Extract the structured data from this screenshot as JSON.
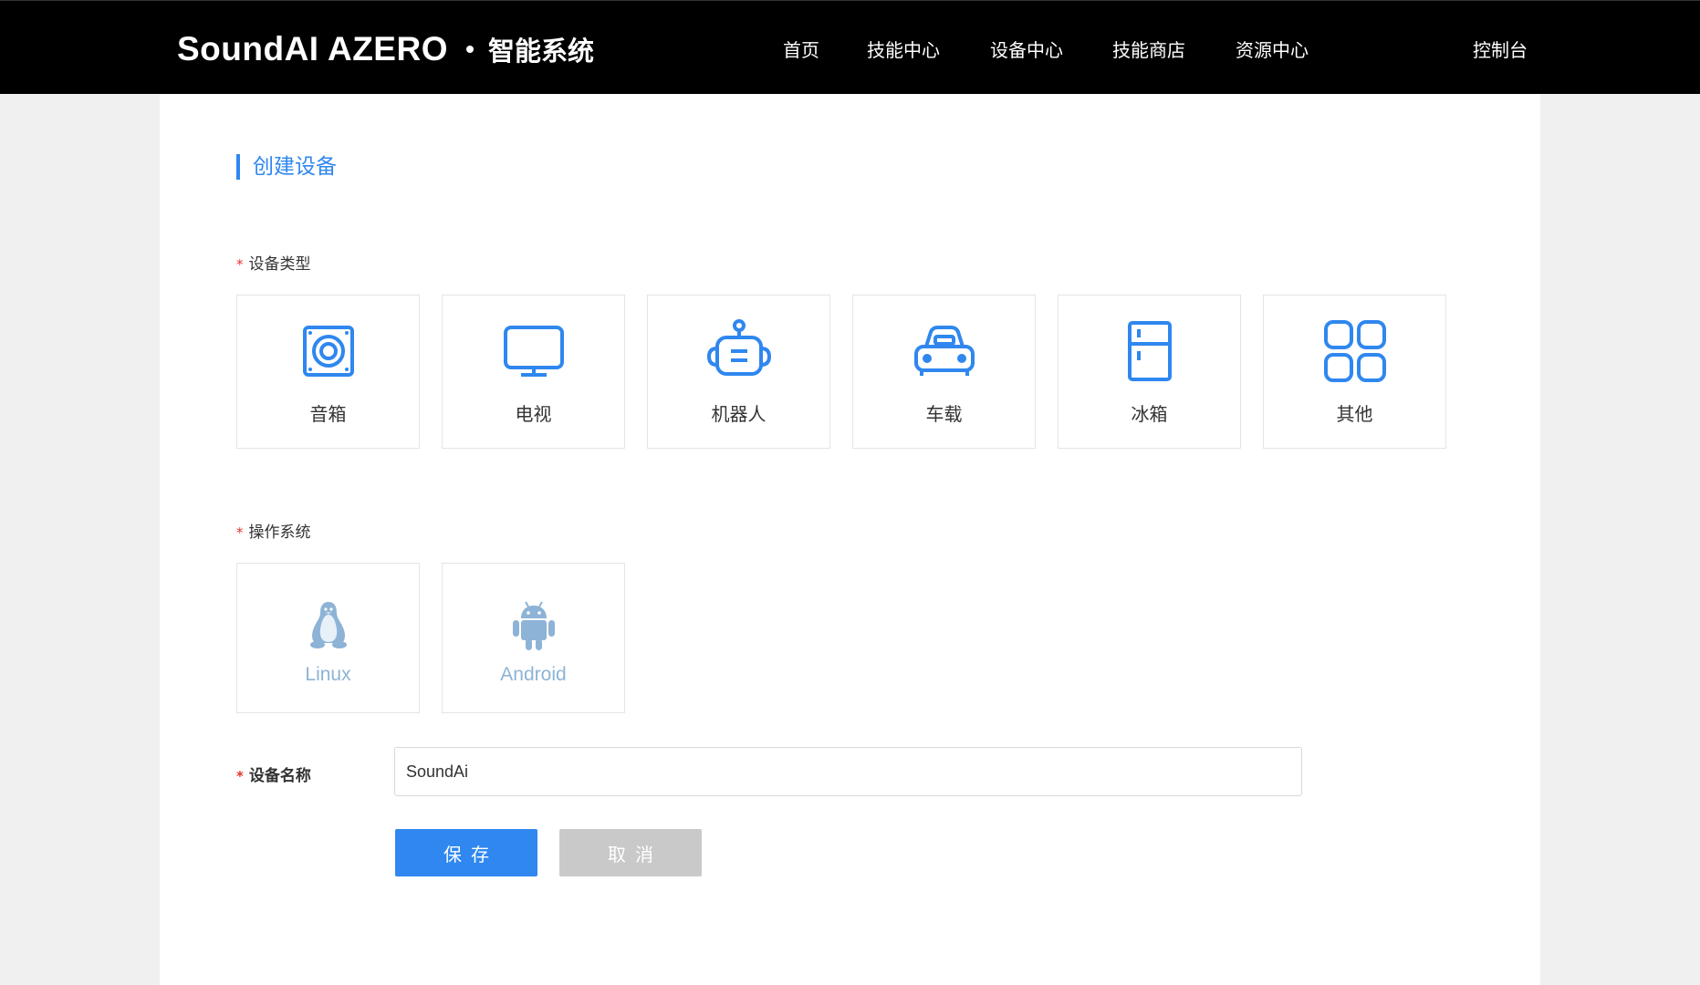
{
  "header": {
    "logo_text": "SoundAI AZERO",
    "logo_subtitle": "智能系统",
    "nav": [
      {
        "label": "首页"
      },
      {
        "label": "技能中心"
      },
      {
        "label": "设备中心"
      },
      {
        "label": "技能商店"
      },
      {
        "label": "资源中心"
      }
    ],
    "console_label": "控制台"
  },
  "page": {
    "title": "创建设备",
    "accent_color": "#2f87ef"
  },
  "device_type": {
    "label": "设备类型",
    "required_mark": "*",
    "options": [
      {
        "label": "音箱",
        "icon": "speaker-icon"
      },
      {
        "label": "电视",
        "icon": "tv-icon"
      },
      {
        "label": "机器人",
        "icon": "robot-icon"
      },
      {
        "label": "车载",
        "icon": "car-icon"
      },
      {
        "label": "冰箱",
        "icon": "fridge-icon"
      },
      {
        "label": "其他",
        "icon": "grid-icon"
      }
    ]
  },
  "os": {
    "label": "操作系统",
    "required_mark": "*",
    "options": [
      {
        "label": "Linux",
        "icon": "linux-penguin-icon"
      },
      {
        "label": "Android",
        "icon": "android-robot-icon"
      }
    ]
  },
  "device_name": {
    "label": "设备名称",
    "required_mark": "*",
    "value": "SoundAi"
  },
  "actions": {
    "save_label": "保存",
    "cancel_label": "取消"
  }
}
